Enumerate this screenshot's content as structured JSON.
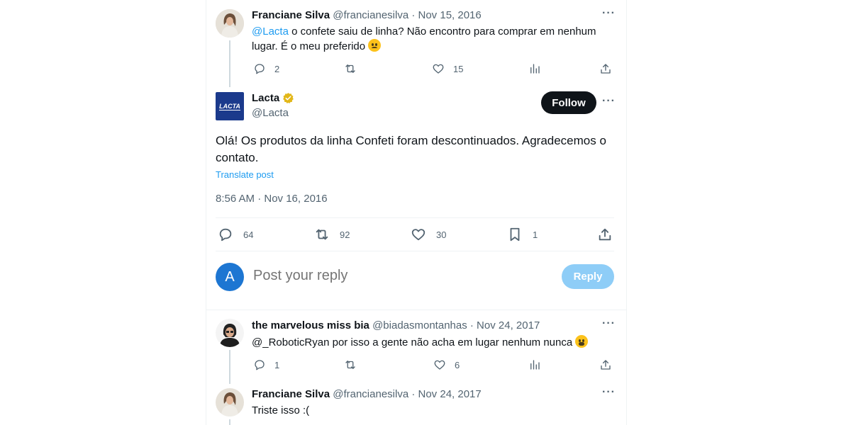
{
  "tweet1": {
    "name": "Franciane Silva",
    "meta": "@francianesilva · Nov 15, 2016",
    "mention": "@Lacta",
    "text": " o confete saiu de linha? Não encontro para comprar em nenhum lugar. É o meu preferido ",
    "emoji": "sad-face-emoji",
    "replies": "2",
    "likes": "15"
  },
  "main_tweet": {
    "name": "Lacta",
    "handle": "@Lacta",
    "logo_text": "LACTA",
    "follow_label": "Follow",
    "text": "Olá! Os produtos da linha Confeti foram descontinuados. Agradecemos o contato.",
    "translate_label": "Translate post",
    "timestamp": "8:56 AM · Nov 16, 2016",
    "replies": "64",
    "reposts": "92",
    "likes": "30",
    "bookmarks": "1"
  },
  "reply_box": {
    "avatar_letter": "A",
    "placeholder": "Post your reply",
    "button_label": "Reply"
  },
  "tweet2": {
    "name": "the marvelous miss bia",
    "meta": "@biadasmontanhas · Nov 24, 2017",
    "mention": "@_RoboticRyan",
    "text": " por isso a gente não acha em lugar nenhum nunca ",
    "emoji": "weary-face-emoji",
    "replies": "1",
    "likes": "6"
  },
  "tweet3": {
    "name": "Franciane Silva",
    "meta": "@francianesilva · Nov 24, 2017",
    "text": "Triste isso :("
  },
  "colors": {
    "accent": "#1d9bf0",
    "text": "#0f1419",
    "muted": "#536471",
    "follow_bg": "#0f1419",
    "reply_btn_bg": "#8ecdf7",
    "lacta_blue": "#1b3a8c"
  }
}
